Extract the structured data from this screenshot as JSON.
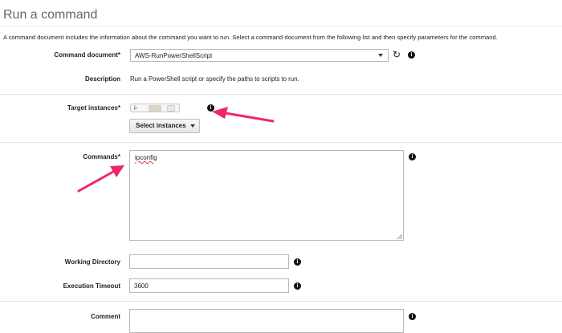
{
  "page": {
    "title": "Run a command",
    "intro": "A command document includes the information about the command you want to run. Select a command document from the following list and then specify parameters for the command."
  },
  "form": {
    "command_document": {
      "label": "Command document*",
      "value": "AWS-RunPowerShellScript"
    },
    "description": {
      "label": "Description",
      "value": "Run a PowerShell script or specify the paths to scripts to run."
    },
    "target_instances": {
      "label": "Target instances*",
      "toggle_text": "i-",
      "button_label": "Select instances"
    },
    "commands": {
      "label": "Commands*",
      "value": "ipconfig"
    },
    "working_directory": {
      "label": "Working Directory",
      "value": ""
    },
    "execution_timeout": {
      "label": "Execution Timeout",
      "value": "3600"
    },
    "comment": {
      "label": "Comment",
      "value": ""
    }
  },
  "icons": {
    "info": "info-icon",
    "refresh": "refresh-icon",
    "arrow": "annotation-arrow"
  },
  "colors": {
    "annotation_arrow": "#ee2a66"
  }
}
